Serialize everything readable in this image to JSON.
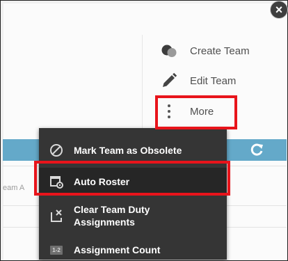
{
  "dialog": {
    "close_glyph": "×"
  },
  "actions": {
    "create_team": "Create Team",
    "edit_team": "Edit Team",
    "more": "More"
  },
  "background": {
    "partial_column_text": "eam A"
  },
  "menu": {
    "items": [
      {
        "label": "Mark Team as Obsolete",
        "icon": "ban-icon"
      },
      {
        "label": "Auto Roster",
        "icon": "roster-settings-icon"
      },
      {
        "label": "Clear Team Duty Assignments",
        "icon": "clear-assignment-icon"
      },
      {
        "label": "Assignment Count",
        "icon": "count-icon",
        "icon_text": "1-2"
      }
    ]
  },
  "colors": {
    "highlight": "#e8141b",
    "menu_bg": "#353535",
    "menu_active_bg": "#262626",
    "toolbar_strip": "#64a9c9"
  },
  "refresh_icon": "refresh-icon"
}
